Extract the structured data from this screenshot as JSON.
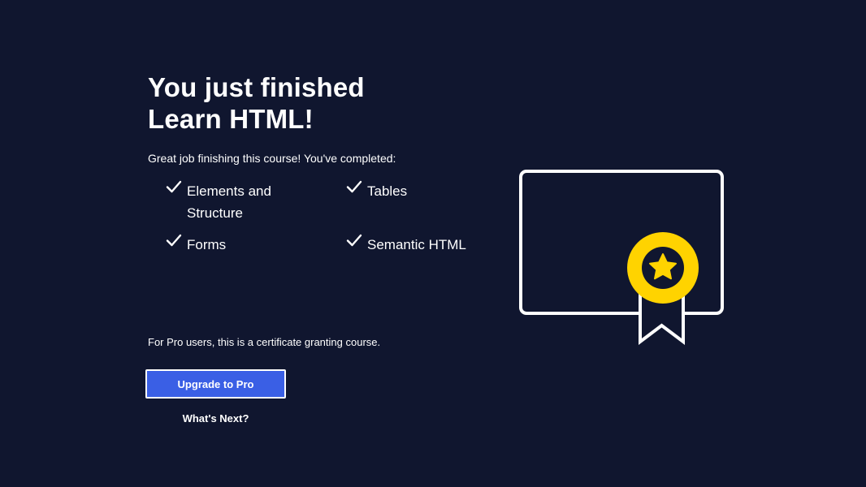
{
  "header": {
    "title_line1": "You just finished",
    "title_line2": "Learn HTML!",
    "subtitle": "Great job finishing this course! You've completed:"
  },
  "modules": [
    {
      "label": "Elements and Structure",
      "icon": "checkmark-icon"
    },
    {
      "label": "Tables",
      "icon": "checkmark-icon"
    },
    {
      "label": "Forms",
      "icon": "checkmark-icon"
    },
    {
      "label": "Semantic HTML",
      "icon": "checkmark-icon"
    }
  ],
  "footer": {
    "pro_note": "For Pro users, this is a certificate granting course.",
    "upgrade_label": "Upgrade to Pro",
    "whats_next_label": "What's Next?"
  },
  "illustration": {
    "icon": "certificate-icon",
    "badge_icon": "star-badge-icon"
  },
  "colors": {
    "background": "#10162f",
    "text": "#ffffff",
    "button": "#3a5fe5",
    "badge": "#ffd300"
  }
}
